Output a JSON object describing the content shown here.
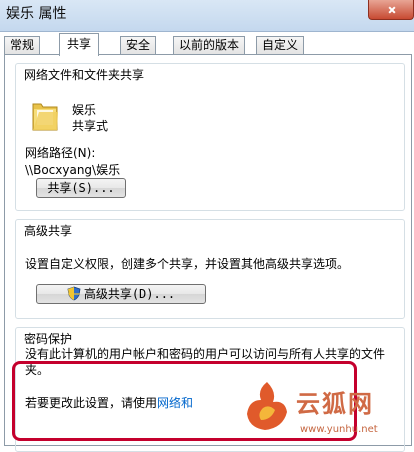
{
  "window": {
    "title": "娱乐 属性",
    "close_icon": "close-icon"
  },
  "tabs": [
    {
      "label": "常规",
      "active": false
    },
    {
      "label": "共享",
      "active": true
    },
    {
      "label": "安全",
      "active": false
    },
    {
      "label": "以前的版本",
      "active": false
    },
    {
      "label": "自定义",
      "active": false
    }
  ],
  "network_share": {
    "group_title": "网络文件和文件夹共享",
    "folder_icon": "folder-icon",
    "folder_name": "娱乐",
    "folder_state": "共享式",
    "path_label": "网络路径(N):",
    "path_value": "\\\\Bocxyang\\娱乐",
    "share_button": "共享(S)..."
  },
  "advanced_share": {
    "group_title": "高级共享",
    "description": "设置自定义权限，创建多个共享，并设置其他高级共享选项。",
    "button_icon": "shield-icon",
    "button_label": "高级共享(D)..."
  },
  "password": {
    "group_title": "密码保护",
    "description": "没有此计算机的用户帐户和密码的用户可以访问与所有人共享的文件夹。",
    "change_prefix": "若要更改此设置，请使用",
    "change_link": "网络和"
  },
  "watermark": {
    "text": "云狐网",
    "url": "www.yunhu.net"
  },
  "colors": {
    "titlebar": "#c4d8ee",
    "annotation": "#c4002d",
    "link": "#0066cc",
    "watermark": "#d06a45"
  }
}
